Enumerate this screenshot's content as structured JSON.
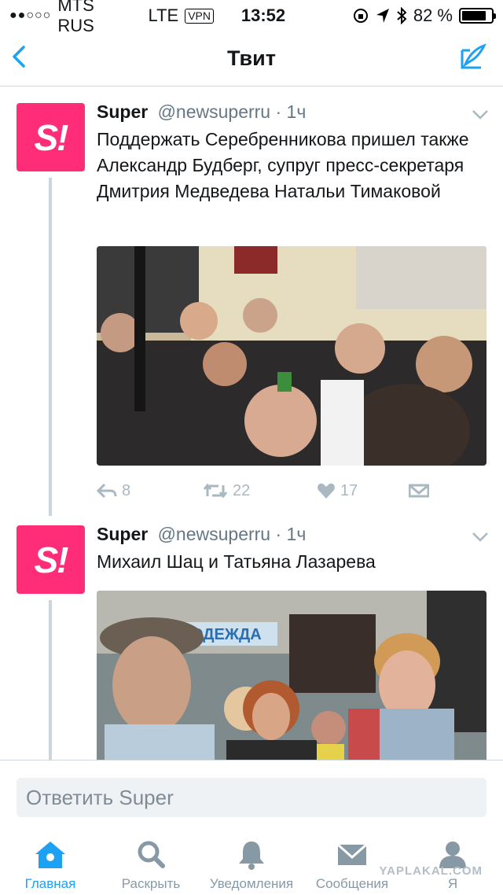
{
  "status_bar": {
    "carrier": "MTS RUS",
    "network": "LTE",
    "vpn": "VPN",
    "time": "13:52",
    "battery": "82 %",
    "battery_level": 0.82
  },
  "nav": {
    "title": "Твит"
  },
  "tweets": [
    {
      "name": "Super",
      "handle": "@newsuperru",
      "time": "· 1ч",
      "avatar_text": "S!",
      "text": "Поддержать Серебренникова пришел также Александр Будберг, супруг пресс-секретаря Дмитрия Медведева Натальи Тимаковой",
      "replies": "8",
      "retweets": "22",
      "likes": "17"
    },
    {
      "name": "Super",
      "handle": "@newsuperru",
      "time": "· 1ч",
      "avatar_text": "S!",
      "text": "Михаил Шац и Татьяна Лазарева",
      "sign_text": "ОДЕЖДА"
    }
  ],
  "reply_box": {
    "placeholder": "Ответить Super"
  },
  "tabs": [
    {
      "label": "Главная",
      "icon": "home-icon"
    },
    {
      "label": "Раскрыть",
      "icon": "search-icon"
    },
    {
      "label": "Уведомления",
      "icon": "bell-icon"
    },
    {
      "label": "Сообщения",
      "icon": "envelope-icon"
    },
    {
      "label": "Я",
      "icon": "person-icon"
    }
  ],
  "watermark": "YAPLAKAL.COM",
  "colors": {
    "accent": "#1da1f2",
    "avatar": "#ff2d78",
    "muted": "#aab8c2"
  }
}
